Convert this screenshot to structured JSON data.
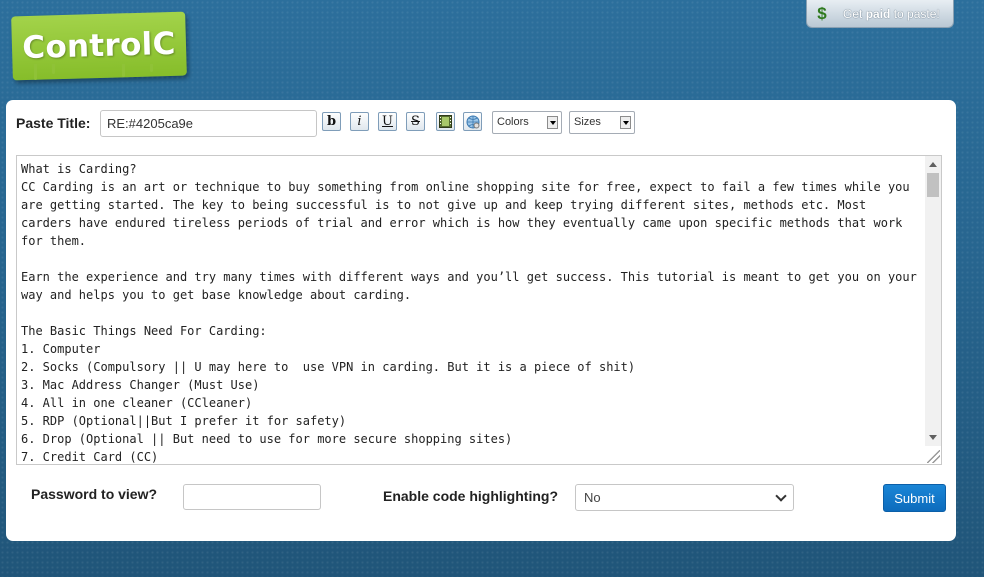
{
  "logo": {
    "text": "ControlC"
  },
  "promo": {
    "prefix": "Get ",
    "bold": "paid",
    "suffix": " to paste!",
    "icon": "dollar-icon"
  },
  "form": {
    "title_label": "Paste Title:",
    "title_value": "RE:#4205ca9e",
    "toolbar": {
      "bold": "b",
      "italic": "i",
      "underline": "U",
      "strike": "S",
      "colors": "Colors",
      "sizes": "Sizes"
    },
    "content_lines": [
      "What is Carding?",
      "CC Carding is an art or technique to buy something from online shopping site for free, expect to fail a few times while you are getting started. The key to being successful is to not give up and keep trying different sites, methods etc. Most carders have endured tireless periods of trial and error which is how they eventually came upon specific methods that work for them.",
      "",
      "Earn the experience and try many times with different ways and you’ll get success. This tutorial is meant to get you on your way and helps you to get base knowledge about carding.",
      "",
      "The Basic Things Need For Carding:",
      "1. Computer",
      "2. Socks (Compulsory || U may here to  use VPN in carding. But it is a piece of shit)",
      "3. Mac Address Changer (Must Use)",
      "4. All in one cleaner (CCleaner)",
      "5. RDP (Optional||But I prefer it for safety)",
      "6. Drop (Optional || But need to use for more secure shopping sites)",
      "7. Credit Card (CC)"
    ],
    "password_label": "Password to view?",
    "password_value": "",
    "highlight_label": "Enable code highlighting?",
    "highlight_value": "No",
    "submit_label": "Submit"
  }
}
